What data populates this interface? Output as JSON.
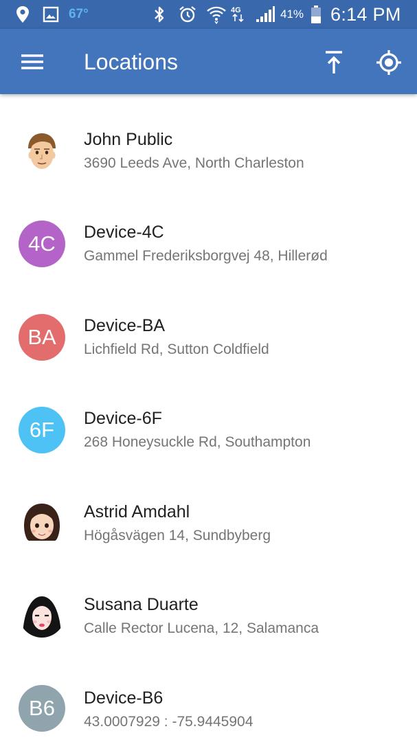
{
  "status_bar": {
    "temperature": "67°",
    "battery": "41%",
    "time": "6:14 PM",
    "network": "4G",
    "icons": [
      "location-pin-icon",
      "gallery-icon",
      "bluetooth-icon",
      "alarm-icon",
      "wifi-icon",
      "lte-icon",
      "signal-icon",
      "battery-icon"
    ]
  },
  "app_bar": {
    "title": "Locations",
    "menu_icon": "hamburger-menu-icon",
    "upload_icon": "upload-icon",
    "locate_icon": "my-location-icon"
  },
  "locations": [
    {
      "name": "John Public",
      "address": "3690 Leeds Ave, North Charleston",
      "avatar_type": "photo",
      "avatar_icon": "john-avatar"
    },
    {
      "name": "Device-4C",
      "address": "Gammel Frederiksborgvej 48, Hillerød",
      "avatar_type": "initials",
      "initials": "4C",
      "color": "#b464c8"
    },
    {
      "name": "Device-BA",
      "address": "Lichfield Rd, Sutton Coldfield",
      "avatar_type": "initials",
      "initials": "BA",
      "color": "#e36d6d"
    },
    {
      "name": "Device-6F",
      "address": "268 Honeysuckle Rd, Southampton",
      "avatar_type": "initials",
      "initials": "6F",
      "color": "#4fc2f5"
    },
    {
      "name": "Astrid Amdahl",
      "address": "Högåsvägen 14, Sundbyberg",
      "avatar_type": "photo",
      "avatar_icon": "astrid-avatar"
    },
    {
      "name": "Susana Duarte",
      "address": "Calle Rector Lucena, 12, Salamanca",
      "avatar_type": "photo",
      "avatar_icon": "susana-avatar"
    },
    {
      "name": "Device-B6",
      "address": "43.0007929 : -75.9445904",
      "avatar_type": "initials",
      "initials": "B6",
      "color": "#90a4ae"
    }
  ]
}
